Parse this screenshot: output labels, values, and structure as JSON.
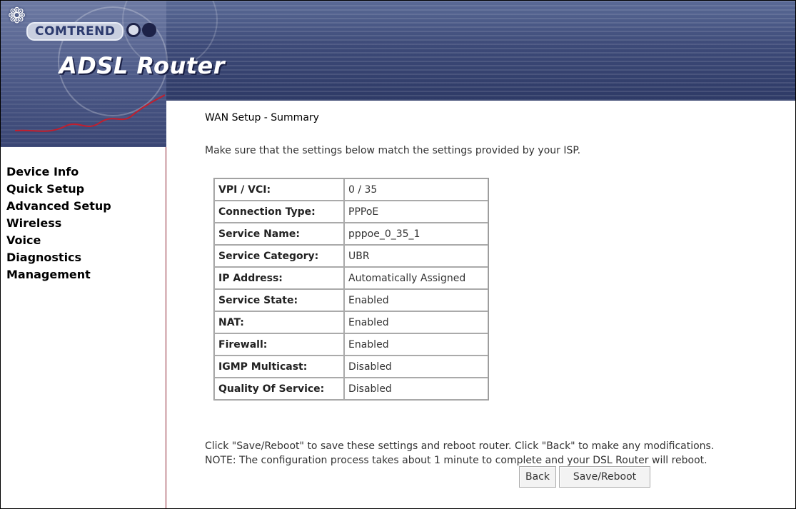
{
  "header": {
    "brand": "COMTREND",
    "product": "ADSL Router"
  },
  "sidebar": {
    "items": [
      {
        "label": "Device Info"
      },
      {
        "label": "Quick Setup"
      },
      {
        "label": "Advanced Setup"
      },
      {
        "label": "Wireless"
      },
      {
        "label": "Voice"
      },
      {
        "label": "Diagnostics"
      },
      {
        "label": "Management"
      }
    ]
  },
  "main": {
    "title": "WAN Setup - Summary",
    "intro": "Make sure that the settings below match the settings provided by your ISP.",
    "rows": [
      {
        "label": "VPI / VCI:",
        "value": "0 / 35"
      },
      {
        "label": "Connection Type:",
        "value": "PPPoE"
      },
      {
        "label": "Service Name:",
        "value": "pppoe_0_35_1"
      },
      {
        "label": "Service Category:",
        "value": "UBR"
      },
      {
        "label": "IP Address:",
        "value": "Automatically Assigned"
      },
      {
        "label": "Service State:",
        "value": "Enabled"
      },
      {
        "label": "NAT:",
        "value": "Enabled"
      },
      {
        "label": "Firewall:",
        "value": "Enabled"
      },
      {
        "label": "IGMP Multicast:",
        "value": "Disabled"
      },
      {
        "label": "Quality Of Service:",
        "value": "Disabled"
      }
    ],
    "note_line1": "Click \"Save/Reboot\" to save these settings and reboot router. Click \"Back\" to make any modifications.",
    "note_line2": "NOTE: The configuration process takes about 1 minute to complete and your DSL Router will reboot.",
    "back_label": "Back",
    "save_label": "Save/Reboot"
  },
  "colors": {
    "header_blue": "#3d4a78",
    "sidebar_border": "#8b1c2a",
    "signal_line": "#c21e2d"
  }
}
